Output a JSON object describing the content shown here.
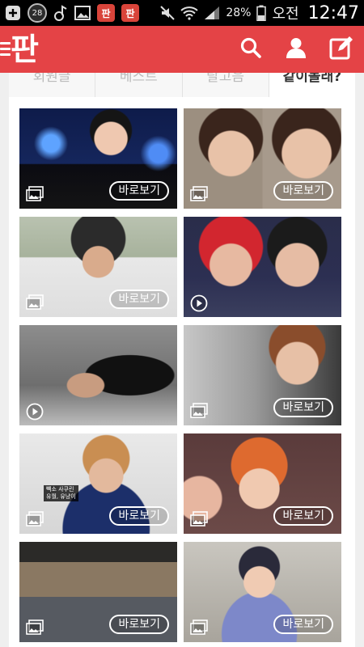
{
  "status_bar": {
    "notification_count": "28",
    "battery": "28%",
    "ampm": "오전",
    "time": "12:47",
    "app_icon_label": "판"
  },
  "app_bar": {
    "logo": "판",
    "brand_color": "#e44346",
    "actions": [
      "search-icon",
      "user-icon",
      "edit-icon"
    ]
  },
  "tabs": [
    {
      "label": "회원글",
      "active": false
    },
    {
      "label": "베스트",
      "active": false
    },
    {
      "label": "랄고음",
      "active": false
    },
    {
      "label": "같이볼래?",
      "active": true
    }
  ],
  "cards": [
    {
      "type": "image",
      "view_label": "바로보기"
    },
    {
      "type": "image",
      "view_label": "바로보기"
    },
    {
      "type": "image",
      "view_label": "바로보기"
    },
    {
      "type": "video",
      "view_label": ""
    },
    {
      "type": "video",
      "view_label": ""
    },
    {
      "type": "image",
      "view_label": "바로보기"
    },
    {
      "type": "image",
      "view_label": "바로보기",
      "caption": "빽소 사쿠린\n유월, 유냥이"
    },
    {
      "type": "image",
      "view_label": "바로보기"
    },
    {
      "type": "image",
      "view_label": "바로보기"
    },
    {
      "type": "image",
      "view_label": "바로보기"
    }
  ]
}
